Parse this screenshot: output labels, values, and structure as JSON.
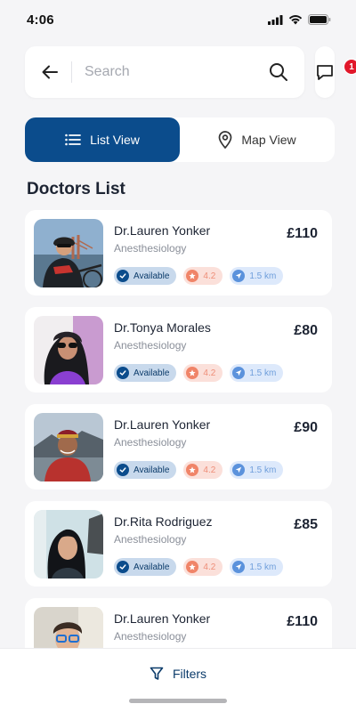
{
  "status_bar": {
    "time": "4:06"
  },
  "search": {
    "placeholder": "Search"
  },
  "messages": {
    "badge_count": "1"
  },
  "view_toggle": {
    "list_label": "List View",
    "map_label": "Map View",
    "active": "list"
  },
  "section_title": "Doctors List",
  "doctors": [
    {
      "name": "Dr.Lauren Yonker",
      "specialty": "Anesthesiology",
      "price": "£110",
      "status": "Available",
      "rating": "4.2",
      "distance": "1.5 km"
    },
    {
      "name": "Dr.Tonya Morales",
      "specialty": "Anesthesiology",
      "price": "£80",
      "status": "Available",
      "rating": "4.2",
      "distance": "1.5 km"
    },
    {
      "name": "Dr.Lauren Yonker",
      "specialty": "Anesthesiology",
      "price": "£90",
      "status": "Available",
      "rating": "4.2",
      "distance": "1.5 km"
    },
    {
      "name": "Dr.Rita Rodriguez",
      "specialty": "Anesthesiology",
      "price": "£85",
      "status": "Available",
      "rating": "4.2",
      "distance": "1.5 km"
    },
    {
      "name": "Dr.Lauren Yonker",
      "specialty": "Anesthesiology",
      "price": "£110"
    }
  ],
  "bottom_bar": {
    "filters_label": "Filters"
  },
  "colors": {
    "primary": "#0b4c8c",
    "badge_red": "#e1172a",
    "rating": "#f08468",
    "distance": "#5b92dc"
  }
}
